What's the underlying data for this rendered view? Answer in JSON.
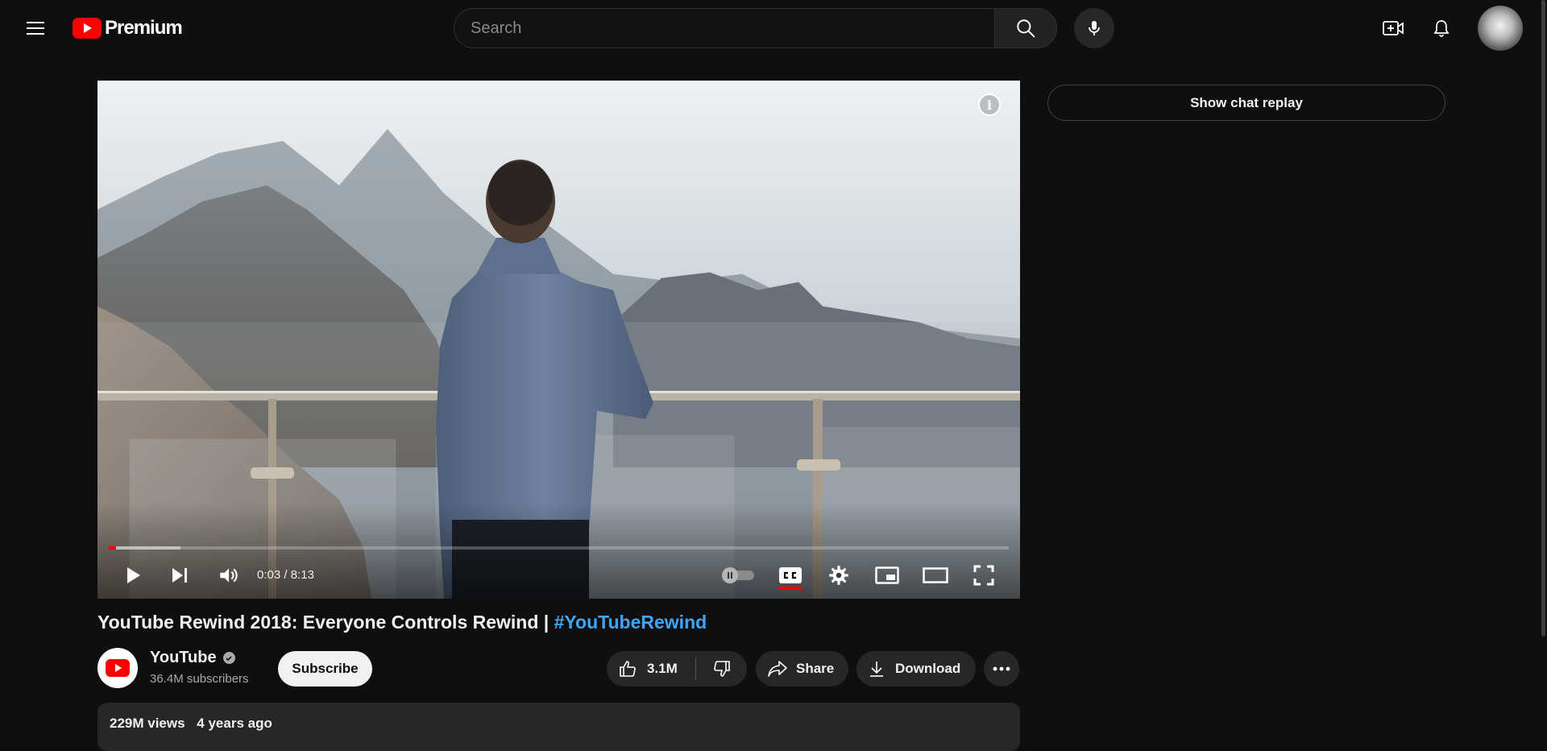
{
  "masthead": {
    "logo_text": "Premium",
    "search_placeholder": "Search"
  },
  "player": {
    "current_time": "0:03",
    "duration": "8:13",
    "time_separator": "/",
    "played_fraction": 0.006,
    "loaded_fraction": 0.08,
    "info_label": "i"
  },
  "chat": {
    "replay_label": "Show chat replay"
  },
  "video": {
    "title": "YouTube Rewind 2018: Everyone Controls Rewind | ",
    "hashtag": "#YouTubeRewind"
  },
  "channel": {
    "name": "YouTube",
    "subscribers": "36.4M subscribers",
    "subscribe_label": "Subscribe"
  },
  "actions": {
    "like_count": "3.1M",
    "share_label": "Share",
    "download_label": "Download"
  },
  "description": {
    "views": "229M views",
    "age": "4 years ago"
  },
  "colors": {
    "background": "#0f0f0f",
    "accent_red": "#ff0000",
    "link_blue": "#3ea6ff"
  }
}
